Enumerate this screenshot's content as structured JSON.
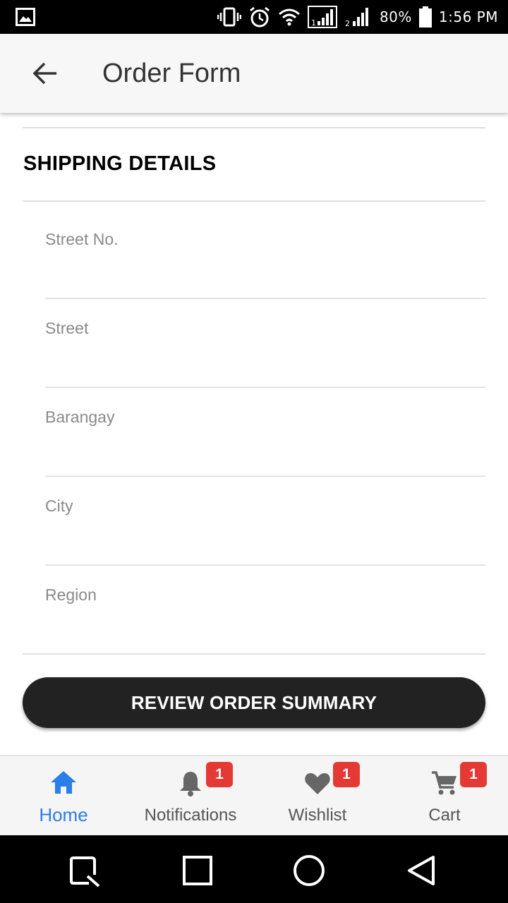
{
  "status_bar": {
    "battery_percent": "80%",
    "time": "1:56 PM",
    "icons": [
      "gallery-icon",
      "vibrate-icon",
      "alarm-icon",
      "wifi-icon",
      "signal-sim1-icon",
      "signal-sim2-icon",
      "battery-icon"
    ]
  },
  "app_bar": {
    "title": "Order Form",
    "back_icon": "arrow-left-icon"
  },
  "form": {
    "section_title": "SHIPPING DETAILS",
    "fields": [
      {
        "label": "Street No.",
        "value": ""
      },
      {
        "label": "Street",
        "value": ""
      },
      {
        "label": "Barangay",
        "value": ""
      },
      {
        "label": "City",
        "value": ""
      },
      {
        "label": "Region",
        "value": ""
      }
    ],
    "submit_label": "REVIEW ORDER SUMMARY"
  },
  "bottom_nav": {
    "items": [
      {
        "label": "Home",
        "icon": "home-icon",
        "active": true
      },
      {
        "label": "Notifications",
        "icon": "bell-icon",
        "badge": "1"
      },
      {
        "label": "Wishlist",
        "icon": "heart-icon",
        "badge": "1"
      },
      {
        "label": "Cart",
        "icon": "cart-icon",
        "badge": "1"
      }
    ]
  },
  "system_nav": {
    "icons": [
      "recent-apps-icon",
      "square-icon",
      "home-circle-icon",
      "back-triangle-icon"
    ]
  },
  "colors": {
    "accent": "#2b7de9",
    "badge": "#e53935",
    "button": "#222222"
  }
}
